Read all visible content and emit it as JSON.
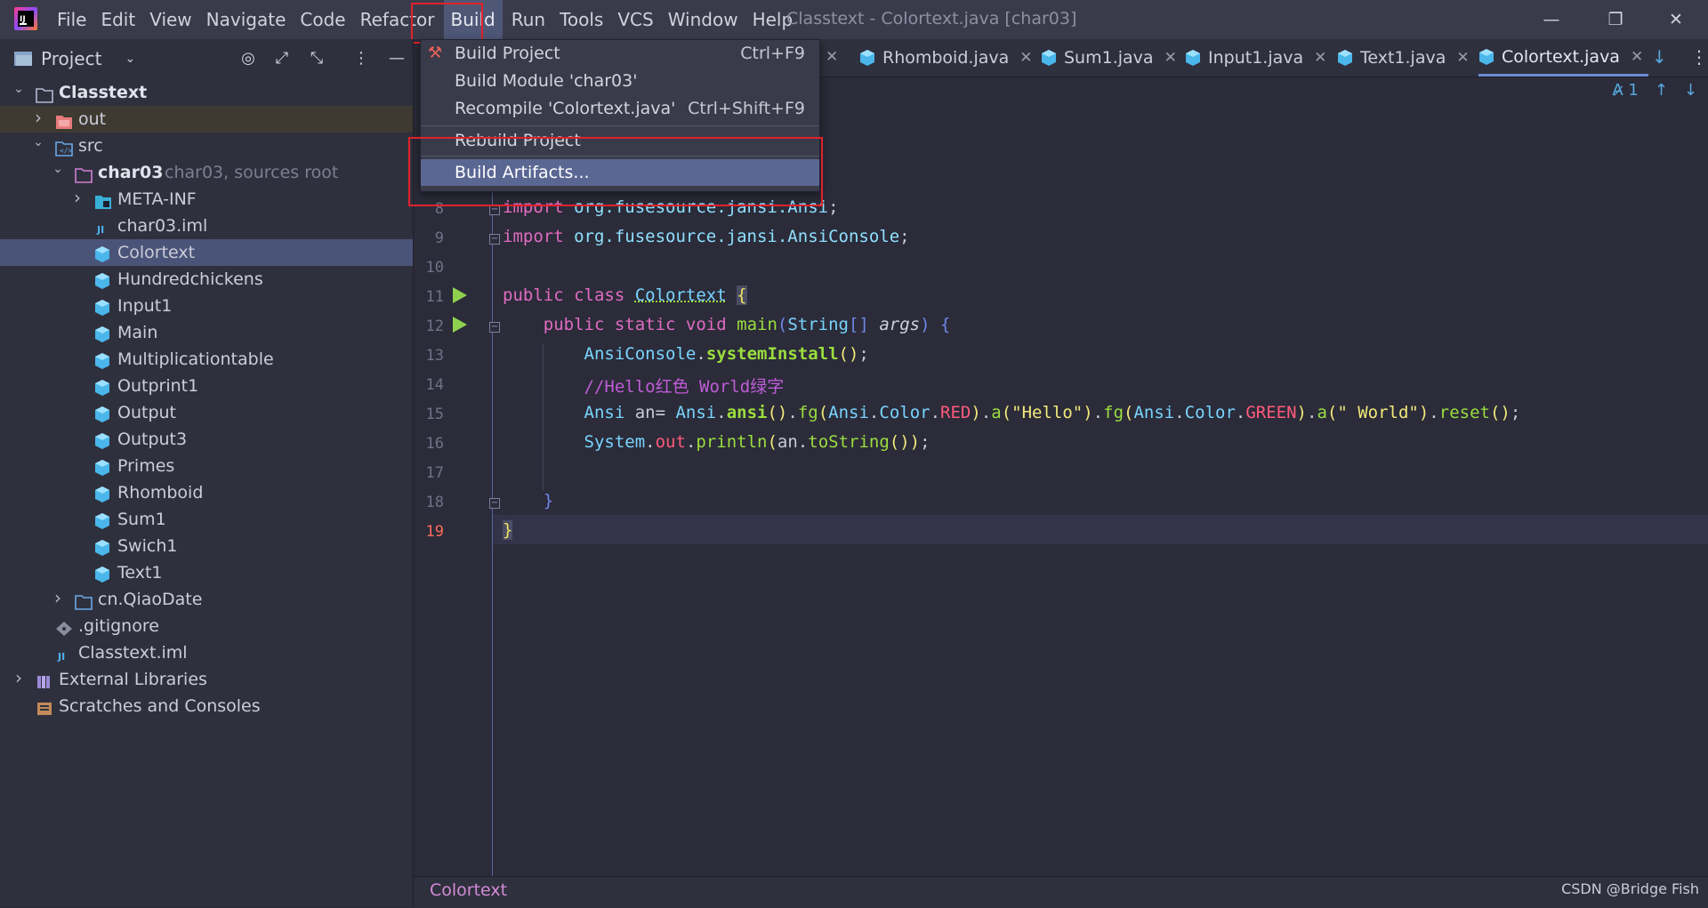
{
  "titlebar": {
    "menu": [
      "File",
      "Edit",
      "View",
      "Navigate",
      "Code",
      "Refactor",
      "Build",
      "Run",
      "Tools",
      "VCS",
      "Window",
      "Help"
    ],
    "window_title": "Classtext - Colortext.java [char03]",
    "minimize": "—",
    "restore": "❐",
    "close": "✕"
  },
  "project_panel": {
    "title": "Project",
    "tree": [
      {
        "label": "Classtext",
        "depth": 0,
        "icon": "folder-icon",
        "arrow": "down",
        "bold": true
      },
      {
        "label": "out",
        "depth": 1,
        "icon": "folder-excluded-icon",
        "arrow": "right"
      },
      {
        "label": "src",
        "depth": 1,
        "icon": "source-folder-icon",
        "arrow": "down"
      },
      {
        "label": "char03",
        "depth": 2,
        "icon": "module-folder-icon",
        "arrow": "down",
        "bold": true,
        "hint": "char03,  sources root"
      },
      {
        "label": "META-INF",
        "depth": 3,
        "icon": "meta-folder-icon",
        "arrow": "right"
      },
      {
        "label": "char03.iml",
        "depth": 3,
        "icon": "iml-file-icon"
      },
      {
        "label": "Colortext",
        "depth": 3,
        "icon": "java-class-icon",
        "selected": true
      },
      {
        "label": "Hundredchickens",
        "depth": 3,
        "icon": "java-class-icon"
      },
      {
        "label": "Input1",
        "depth": 3,
        "icon": "java-class-icon"
      },
      {
        "label": "Main",
        "depth": 3,
        "icon": "java-class-icon"
      },
      {
        "label": "Multiplicationtable",
        "depth": 3,
        "icon": "java-class-icon"
      },
      {
        "label": "Outprint1",
        "depth": 3,
        "icon": "java-class-icon"
      },
      {
        "label": "Output",
        "depth": 3,
        "icon": "java-class-icon"
      },
      {
        "label": "Output3",
        "depth": 3,
        "icon": "java-class-icon"
      },
      {
        "label": "Primes",
        "depth": 3,
        "icon": "java-class-icon"
      },
      {
        "label": "Rhomboid",
        "depth": 3,
        "icon": "java-class-icon"
      },
      {
        "label": "Sum1",
        "depth": 3,
        "icon": "java-class-icon"
      },
      {
        "label": "Swich1",
        "depth": 3,
        "icon": "java-class-icon"
      },
      {
        "label": "Text1",
        "depth": 3,
        "icon": "java-class-icon"
      },
      {
        "label": "cn.QiaoDate",
        "depth": 2,
        "icon": "package-folder-icon",
        "arrow": "right"
      },
      {
        "label": ".gitignore",
        "depth": 1,
        "icon": "gitignore-icon"
      },
      {
        "label": "Classtext.iml",
        "depth": 1,
        "icon": "iml-file-icon"
      },
      {
        "label": "External Libraries",
        "depth": 0,
        "icon": "library-icon",
        "arrow": "right"
      },
      {
        "label": "Scratches and Consoles",
        "depth": 0,
        "icon": "scratches-icon"
      }
    ]
  },
  "tabs": [
    {
      "label": "Rhomboid.java"
    },
    {
      "label": "Sum1.java"
    },
    {
      "label": "Input1.java"
    },
    {
      "label": "Text1.java"
    },
    {
      "label": "Colortext.java",
      "active": true
    }
  ],
  "build_menu": {
    "items": [
      {
        "label": "Build Project",
        "shortcut": "Ctrl+F9"
      },
      {
        "label": "Build Module 'char03'",
        "shortcut": ""
      },
      {
        "label": "Recompile 'Colortext.java'",
        "shortcut": "Ctrl+Shift+F9"
      },
      {
        "label": "Rebuild Project",
        "shortcut": ""
      },
      {
        "label": "Build Artifacts...",
        "shortcut": "",
        "highlighted": true
      }
    ]
  },
  "editor": {
    "inspection_count": "1",
    "line_numbers": [
      "8",
      "9",
      "10",
      "11",
      "12",
      "13",
      "14",
      "15",
      "16",
      "17",
      "18",
      "19"
    ],
    "current_line": "19"
  },
  "status_bar": {
    "breadcrumb": "Colortext",
    "watermark": "CSDN @Bridge Fish"
  },
  "colors": {
    "accent": "#4e5776",
    "selection": "#4a5378",
    "highlight_box": "#e0222a"
  }
}
